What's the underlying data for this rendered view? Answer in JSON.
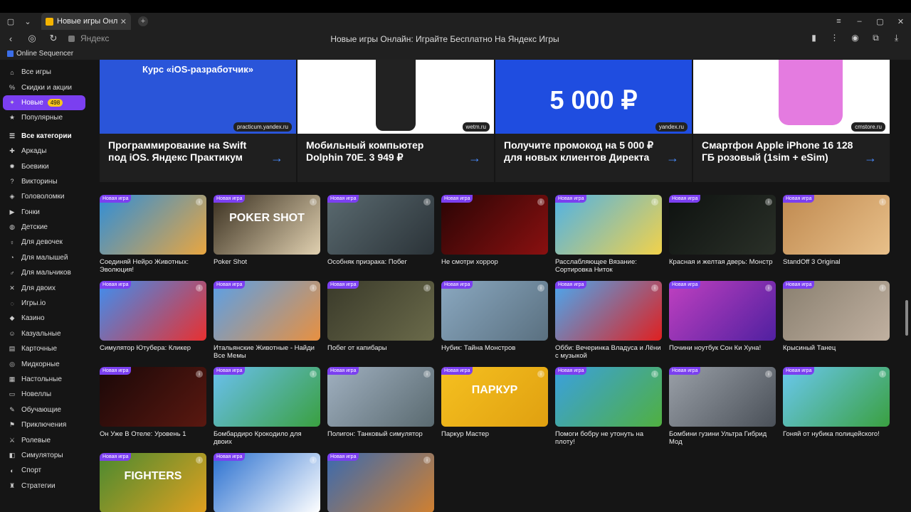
{
  "browser": {
    "tab_title": "Новые игры Онлайн: И",
    "site_label": "Яндекс",
    "page_title": "Новые игры Онлайн: Играйте Бесплатно На Яндекс Игры",
    "bookmark": "Online Sequencer"
  },
  "sidebar": {
    "items": [
      {
        "label": "Все игры",
        "icon": "home-icon"
      },
      {
        "label": "Скидки и акции",
        "icon": "discount-icon"
      },
      {
        "label": "Новые",
        "icon": "sparkle-icon",
        "badge": "498",
        "active": true
      },
      {
        "label": "Популярные",
        "icon": "star-icon"
      }
    ],
    "categories_header": "Все категории",
    "categories": [
      "Аркады",
      "Боевики",
      "Викторины",
      "Головоломки",
      "Гонки",
      "Детские",
      "Для девочек",
      "Для малышей",
      "Для мальчиков",
      "Для двоих",
      "Игры.io",
      "Казино",
      "Казуальные",
      "Карточные",
      "Мидкорные",
      "Настольные",
      "Новеллы",
      "Обучающие",
      "Приключения",
      "Ролевые",
      "Симуляторы",
      "Спорт",
      "Стратегии"
    ]
  },
  "ads": [
    {
      "title": "Программирование на Swift под iOS. Яндекс Практикум",
      "source": "practicum.yandex.ru",
      "img_text": "Курс «iOS-разработчик»",
      "img_bg": "#2a55d9"
    },
    {
      "title": "Мобильный компьютер Dolphin 70E. 3 949 ₽",
      "source": "wetm.ru",
      "img_text": "",
      "img_bg": "#ffffff"
    },
    {
      "title": "Получите промокод на 5 000 ₽ для новых клиентов Директа",
      "source": "yandex.ru",
      "img_text": "5 000 ₽",
      "img_bg": "#1f4de0"
    },
    {
      "title": "Смартфон Apple iPhone 16 128 ГБ розовый (1sim + eSim)",
      "source": "cmstore.ru",
      "img_text": "",
      "img_bg": "#ffffff"
    }
  ],
  "new_badge": "Новая игра",
  "games": [
    {
      "name": "Соединяй Нейро Животных: Эволюция!",
      "c1": "#2f8ed8",
      "c2": "#e9a640",
      "text": ""
    },
    {
      "name": "Poker Shot",
      "c1": "#3a3020",
      "c2": "#e0d0b0",
      "text": "POKER SHOT"
    },
    {
      "name": "Особняк призрака: Побег",
      "c1": "#5a6a70",
      "c2": "#2b3338",
      "text": ""
    },
    {
      "name": "Не смотри хоррор",
      "c1": "#2a0505",
      "c2": "#8a1010",
      "text": ""
    },
    {
      "name": "Расслабляющее Вязание: Сортировка Ниток",
      "c1": "#4fb2e6",
      "c2": "#f2d24a",
      "text": ""
    },
    {
      "name": "Красная и желтая дверь: Монстр",
      "c1": "#0e1210",
      "c2": "#2a3028",
      "text": ""
    },
    {
      "name": "StandOff 3 Original",
      "c1": "#c08a50",
      "c2": "#e8c08a",
      "text": ""
    },
    {
      "name": "Симулятор Ютубера: Кликер",
      "c1": "#3f8ef0",
      "c2": "#e83030",
      "text": ""
    },
    {
      "name": "Итальянские Животные - Найди Все Мемы",
      "c1": "#5aa0e8",
      "c2": "#e89040",
      "text": ""
    },
    {
      "name": "Побег от капибары",
      "c1": "#3a3a2a",
      "c2": "#6a6a4a",
      "text": ""
    },
    {
      "name": "Нубик: Тайна Монстров",
      "c1": "#8aa8c0",
      "c2": "#5a7080",
      "text": ""
    },
    {
      "name": "Обби: Вечеринка Владуса и Лёни с музыкой",
      "c1": "#4aa8f0",
      "c2": "#e02020",
      "text": ""
    },
    {
      "name": "Почини ноутбук Сон Ки Хуна!",
      "c1": "#c040c0",
      "c2": "#5020a0",
      "text": ""
    },
    {
      "name": "Крысиный Танец",
      "c1": "#8a8070",
      "c2": "#c0b0a0",
      "text": ""
    },
    {
      "name": "Он Уже В Отеле: Уровень 1",
      "c1": "#1a0808",
      "c2": "#5a1810",
      "text": ""
    },
    {
      "name": "Бомбардиро Крокодило для двоих",
      "c1": "#6ac0f0",
      "c2": "#3aa040",
      "text": ""
    },
    {
      "name": "Полигон: Танковый симулятор",
      "c1": "#a0b0c0",
      "c2": "#5a6a70",
      "text": ""
    },
    {
      "name": "Паркур Мастер",
      "c1": "#f5c020",
      "c2": "#e0a010",
      "text": "ПАРКУР"
    },
    {
      "name": "Помоги бобру не утонуть на плоту!",
      "c1": "#3aa0e0",
      "c2": "#50b040",
      "text": ""
    },
    {
      "name": "Бомбини гузини Ультра Гибрид Мод",
      "c1": "#9aa0a8",
      "c2": "#4a5058",
      "text": ""
    },
    {
      "name": "Гоняй от нубика полицейского!",
      "c1": "#6ac8f0",
      "c2": "#3aa040",
      "text": ""
    },
    {
      "name": "",
      "c1": "#4a8a30",
      "c2": "#e0a020",
      "text": "FIGHTERS"
    },
    {
      "name": "",
      "c1": "#2a70d0",
      "c2": "#ffffff",
      "text": ""
    },
    {
      "name": "",
      "c1": "#3a6ab0",
      "c2": "#d08030",
      "text": ""
    }
  ]
}
